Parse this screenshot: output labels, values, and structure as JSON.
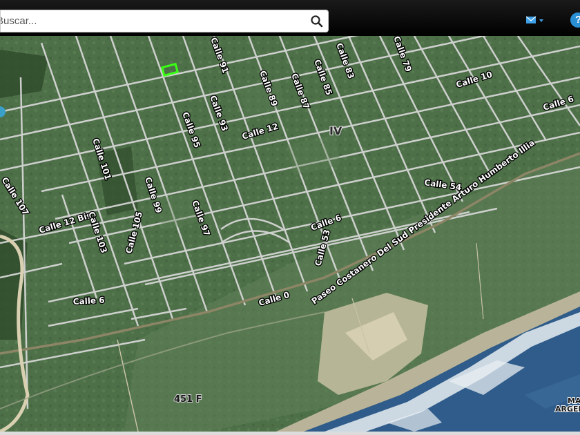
{
  "search": {
    "placeholder": "Buscar..."
  },
  "icons": {
    "search": "search-icon",
    "mail": "envelope-icon",
    "help": "help-icon",
    "caret": "caret-down-icon"
  },
  "help_glyph": "?",
  "map": {
    "streets": {
      "calle_91": "Calle 91",
      "calle_89": "Calle 89",
      "calle_87": "Calle 87",
      "calle_85": "Calle 85",
      "calle_83": "Calle 83",
      "calle_79": "Calle 79",
      "calle_10": "Calle 10",
      "calle_6_ne": "Calle 6",
      "calle_12": "Calle 12",
      "calle_93": "Calle 93",
      "calle_95": "Calle 95",
      "calle_101": "Calle 101",
      "calle_99": "Calle 99",
      "calle_107": "Calle 107",
      "calle_12_bis": "Calle 12 Bis",
      "calle_103": "Calle 103",
      "calle_105": "Calle 105",
      "calle_97": "Calle 97",
      "calle_6_mid": "Calle 6",
      "calle_53": "Calle 53",
      "calle_54": "Calle 54",
      "calle_6_sw": "Calle 6",
      "calle_0": "Calle 0",
      "paseo": "Paseo Costanero Del Sud Presidente Arturo Humberto Illia"
    },
    "zone_label": "IV",
    "route_label": "451 F",
    "sea_label_1": "MA",
    "sea_label_2": "ARGEN"
  },
  "colors": {
    "selection": "#39ff14",
    "accent": "#2b8fd6",
    "road": "#dcdcdc"
  }
}
